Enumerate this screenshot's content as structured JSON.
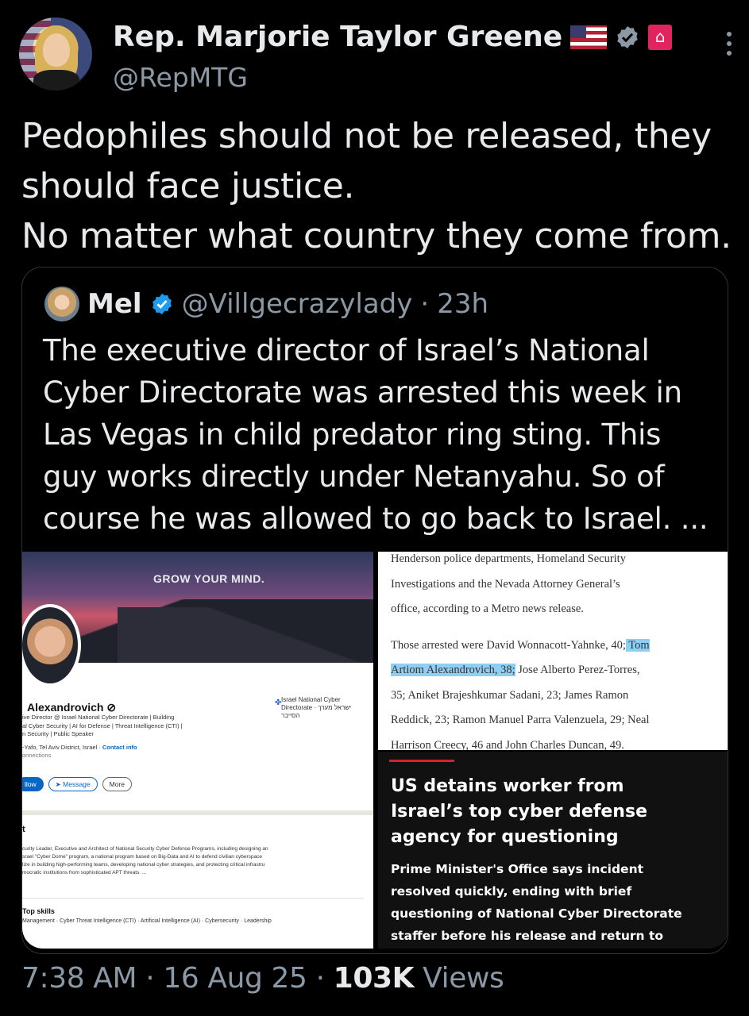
{
  "author": {
    "display_name": "Rep. Marjorie Taylor Greene",
    "handle": "@RepMTG",
    "icons": [
      "us-flag-icon",
      "verified-icon",
      "government-label-icon"
    ]
  },
  "tweet": {
    "lines": [
      "Pedophiles should not be released, they",
      "should face justice.",
      "No matter what country they come from."
    ]
  },
  "quoted_tweet": {
    "name": "Mel",
    "handle": "@Villgecrazylady",
    "separator": "·",
    "time": "23h",
    "lines": [
      "The executive director of Israel’s National",
      "Cyber Directorate was arrested this week in",
      "Las Vegas in child predator ring sting. This",
      "guy works directly under Netanyahu. So of",
      "course he was allowed to go back to Israel. ..."
    ]
  },
  "linkedin": {
    "banner_text": "GROW YOUR MIND.",
    "name": "Alexandrovich",
    "org": "Israel National Cyber Directorate · ישראל מערך הסייבר",
    "sub_lines": [
      "ive Director @ Israel National Cyber Directorate | Building",
      "al Cyber Security | AI for Defense | Threat Intelligence (CTI) |",
      "n Security | Public Speaker"
    ],
    "location": "-Yafo, Tel Aviv District, Israel · ",
    "contact_info": "Contact info",
    "connections": "onnections",
    "buttons": {
      "follow": "llow",
      "message": "Message",
      "more": "More"
    },
    "about_heading": "t",
    "about_lines": [
      "curity Leader, Executive and Architect of National Security Cyber Defense Programs, including designing an",
      "srael \"Cyber Dome\" program, a national program based on Big-Data and AI to defend civilian cyberspace",
      "lize in building high-performing teams, developing national cyber strategies, and protecting critical infrastru",
      "mocratic institutions from sophisticated APT threats. ..."
    ],
    "skills_heading": "Top skills",
    "skills": "Management · Cyber Threat Intelligence (CTI) · Artificial Intelligence (AI) · Cybersecurity · Leadership"
  },
  "article": {
    "lines_top": [
      "Henderson police departments, Homeland Security",
      "Investigations and the Nevada Attorney General’s",
      "office, according to a Metro news release."
    ],
    "line_a": "Those arrested were David Wonnacott-Yahnke, 40;",
    "line_a_hl": " Tom",
    "line_b_hl": "Artiom Alexandrovich, 38;",
    "line_b": " Jose Alberto Perez-Torres,",
    "lines_rest": [
      "35; Aniket Brajeshkumar Sadani, 23; James Ramon",
      "Reddick, 23; Ramon Manuel Parra Valenzuela, 29; Neal",
      "Harrison Creecy, 46 and John Charles Duncan, 49."
    ]
  },
  "news": {
    "headline_lines": [
      "US detains worker from",
      "Israel’s top cyber defense",
      "agency for questioning"
    ],
    "sub_lines": [
      "Prime Minister's Office says incident",
      "resolved quickly, ending with brief",
      "questioning of National Cyber Directorate",
      "staffer before his release and return to"
    ]
  },
  "footer": {
    "time": "7:38 AM",
    "sep1": " · ",
    "date": "16 Aug 25",
    "sep2": " · ",
    "views_count": "103K",
    "views_label": " Views"
  },
  "colors": {
    "background": "#000000",
    "text": "#e7e9ea",
    "muted": "#8b98a5",
    "verified": "#1d9bf0",
    "news_accent": "#d2232a"
  }
}
